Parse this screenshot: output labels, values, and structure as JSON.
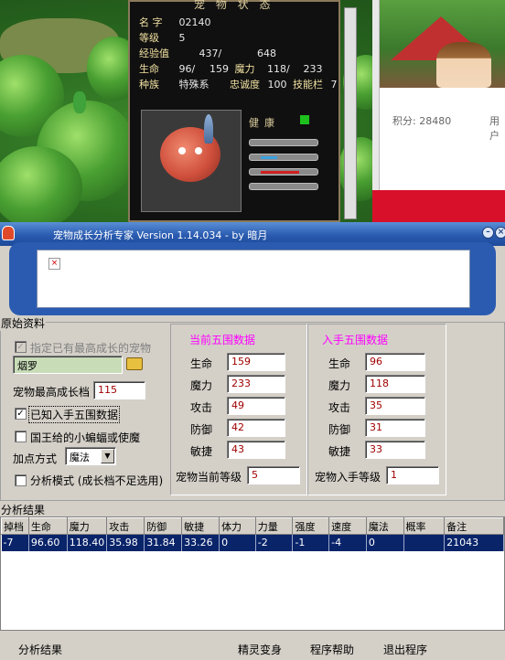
{
  "pet_status": {
    "title": "宠 物 状 态",
    "name_label": "名 字",
    "name_value": "02140",
    "level_label": "等级",
    "level_value": "5",
    "exp_label": "经验值",
    "exp_value": "437/",
    "exp_next": "648",
    "hp_label": "生命",
    "hp_value": "96/",
    "hp_max": "159",
    "mp_label": "魔力",
    "mp_value": "118/",
    "mp_max": "233",
    "race_label": "种族",
    "race_value": "特殊系",
    "loyalty_label": "忠诚度",
    "loyalty_value": "100",
    "skill_label": "技能栏",
    "skill_value": "7",
    "health_label": "健康",
    "health_color": "#1ec01e"
  },
  "browser": {
    "score": "积分: 28480",
    "used": "用户"
  },
  "window": {
    "title": "宠物成长分析专家 Version 1.14.034 - by 暗月",
    "minimize_icon": "minimize-icon",
    "close_icon": "close-icon"
  },
  "raw_data": {
    "section_label": "原始资料",
    "chk_best_growth": "指定已有最高成长的宠物",
    "pet_name": "烟罗",
    "max_growth_label": "宠物最高成长档",
    "max_growth_value": "115",
    "chk_known_stats": "已知入手五围数据",
    "chk_king_bat": "国王给的小蝙蝠或使魔",
    "add_mode_label": "加点方式",
    "add_mode_value": "魔法",
    "chk_analysis_mode": "分析模式 (成长档不足选用)"
  },
  "current_stats": {
    "header": "当前五围数据",
    "hp_label": "生命",
    "hp": "159",
    "mp_label": "魔力",
    "mp": "233",
    "atk_label": "攻击",
    "atk": "49",
    "def_label": "防御",
    "def": "42",
    "agi_label": "敏捷",
    "agi": "43",
    "level_label": "宠物当前等级",
    "level": "5"
  },
  "initial_stats": {
    "header": "入手五围数据",
    "hp_label": "生命",
    "hp": "96",
    "mp_label": "魔力",
    "mp": "118",
    "atk_label": "攻击",
    "atk": "35",
    "def_label": "防御",
    "def": "31",
    "agi_label": "敏捷",
    "agi": "33",
    "level_label": "宠物入手等级",
    "level": "1"
  },
  "results": {
    "section_label": "分析结果",
    "columns": [
      "掉档",
      "生命",
      "魔力",
      "攻击",
      "防御",
      "敏捷",
      "体力",
      "力量",
      "强度",
      "速度",
      "魔法",
      "概率",
      "备注"
    ],
    "rows": [
      [
        "-7",
        "96.60",
        "118.40",
        "35.98",
        "31.84",
        "33.26",
        "0",
        "-2",
        "-1",
        "-4",
        "0",
        "",
        "21043"
      ]
    ]
  },
  "bottom_bar": {
    "analyze": "分析结果",
    "transform": "精灵变身",
    "help": "程序帮助",
    "exit": "退出程序"
  }
}
